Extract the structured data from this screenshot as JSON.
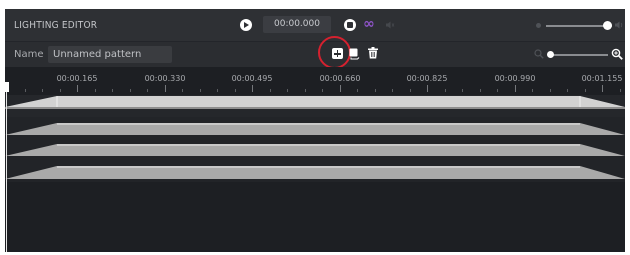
{
  "titlebar": {
    "title": "LIGHTING EDITOR",
    "time": "00:00.000",
    "icons": {
      "play": "play-icon",
      "stop": "stop-icon",
      "loop": "infinity-icon",
      "loop_symbol": "∞",
      "loop_color": "#8f54c9",
      "volume": "speaker-icon"
    }
  },
  "pattern": {
    "name_label": "Name",
    "name_value": "Unnamed pattern",
    "actions": [
      "add-icon",
      "copy-icon",
      "trash-icon"
    ],
    "zoom_icons": [
      "zoom-out-icon",
      "zoom-in-icon"
    ]
  },
  "ruler": {
    "labels": [
      "00:00.165",
      "00:00.330",
      "00:00.495",
      "00:00.660",
      "00:00.825",
      "00:00.990",
      "00:01.155"
    ]
  },
  "tracks": {
    "count": 4
  },
  "colors": {
    "background": "#1d1f23",
    "panel": "#2e3034",
    "highlight": "#d5212f",
    "track_fill": "#a6a6a6"
  }
}
